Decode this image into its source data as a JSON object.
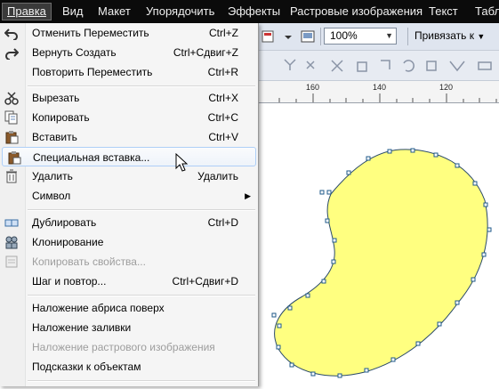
{
  "menubar": {
    "items": [
      {
        "label": "Правка",
        "active": true
      },
      {
        "label": "Вид"
      },
      {
        "label": "Макет"
      },
      {
        "label": "Упорядочить"
      },
      {
        "label": "Эффекты"
      },
      {
        "label": "Растровые изображения"
      },
      {
        "label": "Текст"
      },
      {
        "label": "Табл"
      }
    ]
  },
  "toolbar": {
    "zoom_value": "100%",
    "snap_label": "Привязать к"
  },
  "ruler": {
    "labels": [
      "160",
      "140",
      "120"
    ]
  },
  "edit_menu": {
    "items": [
      {
        "label": "Отменить Переместить",
        "shortcut": "Ctrl+Z",
        "icon": "undo-icon"
      },
      {
        "label": "Вернуть Создать",
        "shortcut": "Ctrl+Сдвиг+Z",
        "icon": "redo-icon"
      },
      {
        "label": "Повторить Переместить",
        "shortcut": "Ctrl+R",
        "icon": ""
      },
      {
        "label": "Вырезать",
        "shortcut": "Ctrl+X",
        "icon": "scissors-icon"
      },
      {
        "label": "Копировать",
        "shortcut": "Ctrl+C",
        "icon": "copy-icon"
      },
      {
        "label": "Вставить",
        "shortcut": "Ctrl+V",
        "icon": "paste-icon"
      },
      {
        "label": "Специальная вставка...",
        "shortcut": "",
        "icon": "paste-special-icon",
        "hover": true
      },
      {
        "label": "Удалить",
        "shortcut": "Удалить",
        "icon": "trash-icon"
      },
      {
        "label": "Символ",
        "shortcut": "",
        "icon": "",
        "submenu": true
      },
      {
        "label": "Дублировать",
        "shortcut": "Ctrl+D",
        "icon": "duplicate-icon"
      },
      {
        "label": "Клонирование",
        "shortcut": "",
        "icon": "clone-icon"
      },
      {
        "label": "Копировать свойства...",
        "shortcut": "",
        "icon": "copy-properties-icon",
        "disabled": true
      },
      {
        "label": "Шаг и повтор...",
        "shortcut": "Ctrl+Сдвиг+D",
        "icon": ""
      },
      {
        "label": "Наложение абриса поверх",
        "shortcut": "",
        "icon": ""
      },
      {
        "label": "Наложение заливки",
        "shortcut": "",
        "icon": ""
      },
      {
        "label": "Наложение растрового изображения",
        "shortcut": "",
        "icon": "",
        "disabled": true
      },
      {
        "label": "Подсказки к объектам",
        "shortcut": "",
        "icon": ""
      }
    ]
  },
  "colors": {
    "shape_fill": "#ffff80",
    "shape_outline": "#2a4a6a",
    "hover_border": "#aecff7"
  }
}
